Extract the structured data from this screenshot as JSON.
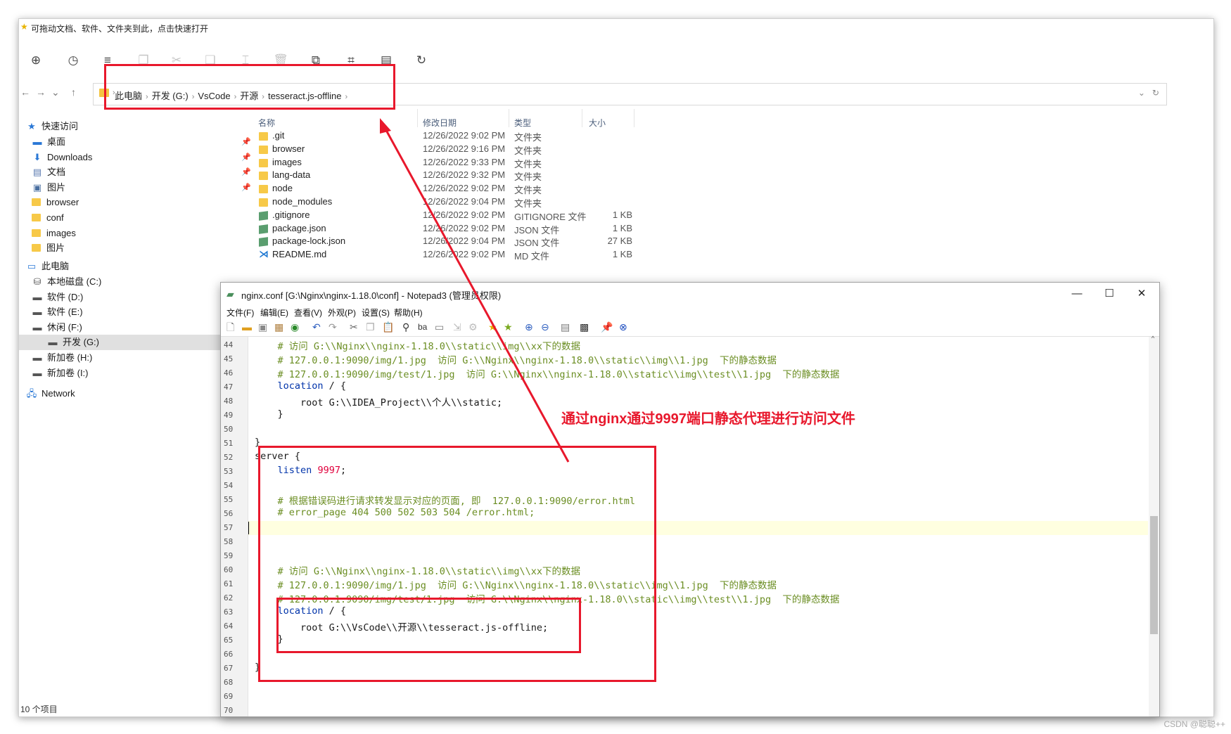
{
  "explorer": {
    "title": "可拖动文档、软件、文件夹到此，点击快速打开",
    "toolbar_icons": [
      "new-circle-icon",
      "history-icon",
      "view-list-icon",
      "copy-icon",
      "cut-icon",
      "paste-icon",
      "rename-icon",
      "delete-icon",
      "open-window-icon",
      "crop-icon",
      "properties-icon",
      "refresh-circle-icon"
    ],
    "address": {
      "crumbs": [
        "此电脑",
        "开发 (G:)",
        "VsCode",
        "开源",
        "tesseract.js-offline"
      ]
    },
    "columns": {
      "name": "名称",
      "date": "修改日期",
      "type": "类型",
      "size": "大小"
    },
    "files": [
      {
        "name": ".git",
        "date": "12/26/2022 9:02 PM",
        "type": "文件夹",
        "size": "",
        "kind": "folder"
      },
      {
        "name": "browser",
        "date": "12/26/2022 9:16 PM",
        "type": "文件夹",
        "size": "",
        "kind": "folder"
      },
      {
        "name": "images",
        "date": "12/26/2022 9:33 PM",
        "type": "文件夹",
        "size": "",
        "kind": "folder"
      },
      {
        "name": "lang-data",
        "date": "12/26/2022 9:32 PM",
        "type": "文件夹",
        "size": "",
        "kind": "folder"
      },
      {
        "name": "node",
        "date": "12/26/2022 9:02 PM",
        "type": "文件夹",
        "size": "",
        "kind": "folder"
      },
      {
        "name": "node_modules",
        "date": "12/26/2022 9:04 PM",
        "type": "文件夹",
        "size": "",
        "kind": "folder"
      },
      {
        "name": ".gitignore",
        "date": "12/26/2022 9:02 PM",
        "type": "GITIGNORE 文件",
        "size": "1 KB",
        "kind": "file"
      },
      {
        "name": "package.json",
        "date": "12/26/2022 9:02 PM",
        "type": "JSON 文件",
        "size": "1 KB",
        "kind": "file"
      },
      {
        "name": "package-lock.json",
        "date": "12/26/2022 9:04 PM",
        "type": "JSON 文件",
        "size": "27 KB",
        "kind": "file"
      },
      {
        "name": "README.md",
        "date": "12/26/2022 9:02 PM",
        "type": "MD 文件",
        "size": "1 KB",
        "kind": "vscode"
      }
    ],
    "sidebar": {
      "quick_access": "快速访问",
      "quick_items": [
        {
          "label": "桌面",
          "icon": "desktop-icon",
          "pinned": true
        },
        {
          "label": "Downloads",
          "icon": "download-arrow-icon",
          "pinned": true
        },
        {
          "label": "文档",
          "icon": "document-icon",
          "pinned": true
        },
        {
          "label": "图片",
          "icon": "pictures-icon",
          "pinned": true
        },
        {
          "label": "browser",
          "icon": "folder-icon",
          "pinned": false
        },
        {
          "label": "conf",
          "icon": "folder-icon",
          "pinned": false
        },
        {
          "label": "images",
          "icon": "folder-icon",
          "pinned": false
        },
        {
          "label": "图片",
          "icon": "folder-icon",
          "pinned": false
        }
      ],
      "this_pc": "此电脑",
      "drives": [
        {
          "label": "本地磁盘 (C:)",
          "selected": false
        },
        {
          "label": "软件 (D:)",
          "selected": false
        },
        {
          "label": "软件 (E:)",
          "selected": false
        },
        {
          "label": "休闲 (F:)",
          "selected": false
        },
        {
          "label": "开发 (G:)",
          "selected": true
        },
        {
          "label": "新加卷 (H:)",
          "selected": false
        },
        {
          "label": "新加卷 (I:)",
          "selected": false
        }
      ],
      "network": "Network"
    },
    "status": "10 个项目"
  },
  "notepad": {
    "title": "nginx.conf [G:\\Nginx\\nginx-1.18.0\\conf] - Notepad3  (管理员权限)",
    "menu": [
      "文件(F)",
      "编辑(E)",
      "查看(V)",
      "外观(P)",
      "设置(S)",
      "帮助(H)"
    ],
    "window_buttons": {
      "minimize": "—",
      "maximize": "☐",
      "close": "✕"
    },
    "lines": [
      {
        "n": "44",
        "text": "    # 访问 G:\\\\Nginx\\\\nginx-1.18.0\\\\static\\\\img\\\\xx下的数据",
        "style": "cm"
      },
      {
        "n": "45",
        "text": "    # 127.0.0.1:9090/img/1.jpg  访问 G:\\\\Nginx\\\\nginx-1.18.0\\\\static\\\\img\\\\1.jpg  下的静态数据",
        "style": "cm"
      },
      {
        "n": "46",
        "text": "    # 127.0.0.1:9090/img/test/1.jpg  访问 G:\\\\Nginx\\\\nginx-1.18.0\\\\static\\\\img\\\\test\\\\1.jpg  下的静态数据",
        "style": "cm"
      },
      {
        "n": "47",
        "kw": "location",
        "rest": " / {",
        "indent": "    ",
        "style": "kw"
      },
      {
        "n": "48",
        "text": "        root G:\\\\IDEA_Project\\\\个人\\\\static;",
        "style": ""
      },
      {
        "n": "49",
        "text": "    }",
        "style": ""
      },
      {
        "n": "50",
        "text": "",
        "style": ""
      },
      {
        "n": "51",
        "text": "}",
        "style": ""
      },
      {
        "n": "52",
        "text": "server {",
        "style": ""
      },
      {
        "n": "53",
        "kw": "listen",
        "num": "9997",
        "rest": ";",
        "indent": "    ",
        "style": "kwnum"
      },
      {
        "n": "54",
        "text": "",
        "style": ""
      },
      {
        "n": "55",
        "text": "    # 根据错误码进行请求转发显示对应的页面, 即  127.0.0.1:9090/error.html",
        "style": "cm"
      },
      {
        "n": "56",
        "text": "    # error_page 404 500 502 503 504 /error.html;",
        "style": "cm"
      },
      {
        "n": "57",
        "text": "",
        "style": ""
      },
      {
        "n": "58",
        "text": "",
        "style": ""
      },
      {
        "n": "59",
        "text": "",
        "style": ""
      },
      {
        "n": "60",
        "text": "    # 访问 G:\\\\Nginx\\\\nginx-1.18.0\\\\static\\\\img\\\\xx下的数据",
        "style": "cm"
      },
      {
        "n": "61",
        "text": "    # 127.0.0.1:9090/img/1.jpg  访问 G:\\\\Nginx\\\\nginx-1.18.0\\\\static\\\\img\\\\1.jpg  下的静态数据",
        "style": "cm"
      },
      {
        "n": "62",
        "text": "    # 127.0.0.1:9090/img/test/1.jpg  访问 G:\\\\Nginx\\\\nginx-1.18.0\\\\static\\\\img\\\\test\\\\1.jpg  下的静态数据",
        "style": "cm"
      },
      {
        "n": "63",
        "kw": "location",
        "rest": " / {",
        "indent": "    ",
        "style": "kw"
      },
      {
        "n": "64",
        "text": "        root G:\\\\VsCode\\\\开源\\\\tesseract.js-offline;",
        "style": ""
      },
      {
        "n": "65",
        "text": "    }",
        "style": ""
      },
      {
        "n": "66",
        "text": "",
        "style": ""
      },
      {
        "n": "67",
        "text": "}",
        "style": ""
      },
      {
        "n": "68",
        "text": "",
        "style": ""
      },
      {
        "n": "69",
        "text": "",
        "style": ""
      },
      {
        "n": "70",
        "text": "",
        "style": ""
      }
    ],
    "current_line": "57"
  },
  "annotation": {
    "text": "通过nginx通过9997端口静态代理进行访问文件",
    "color": "#e8182c"
  },
  "watermark": "CSDN @聪聪++"
}
